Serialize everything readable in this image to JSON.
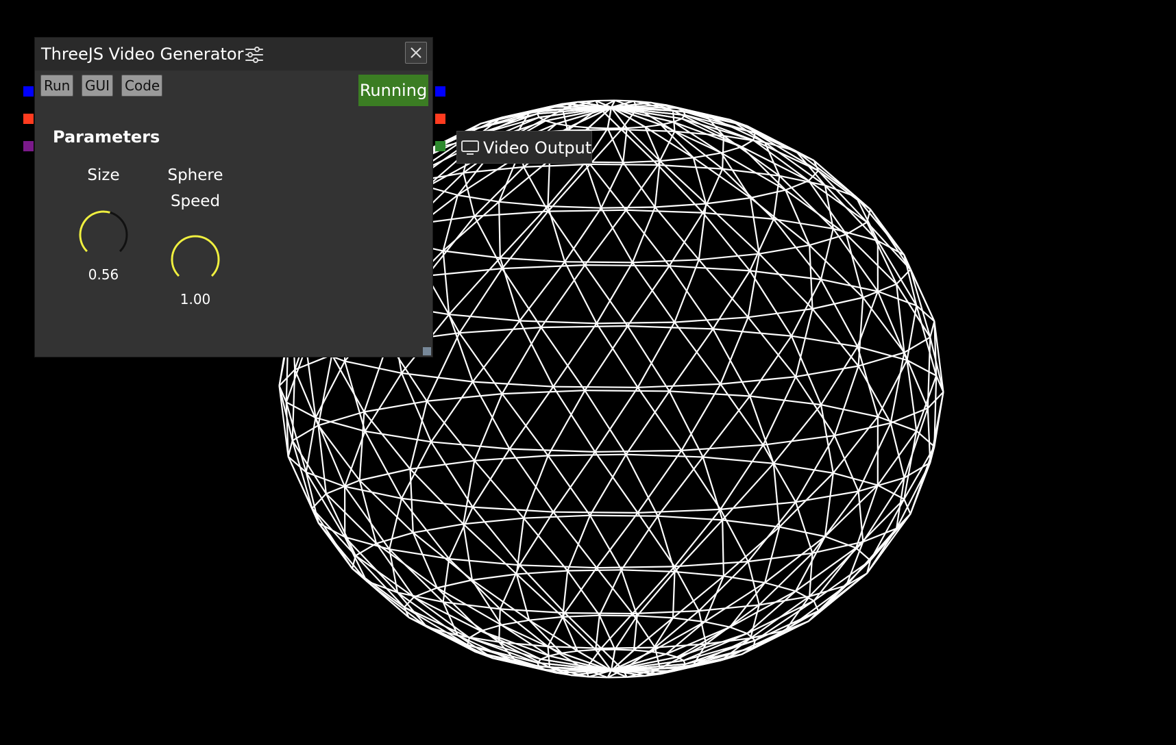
{
  "window": {
    "title": "ThreeJS Video Generator",
    "title_icon": "sliders-icon",
    "close_icon": "close-icon"
  },
  "toolbar": {
    "run_label": "Run",
    "gui_label": "GUI",
    "code_label": "Code"
  },
  "status": {
    "label": "Running",
    "color": "#3b7d23"
  },
  "parameters": {
    "heading": "Parameters",
    "knobs": [
      {
        "label": "Size",
        "label_line2": "",
        "value_text": "0.56",
        "value": 0.56
      },
      {
        "label": "Sphere",
        "label_line2": "Speed",
        "value_text": "1.00",
        "value": 1.0
      }
    ],
    "knob_accent_color": "#f0f040"
  },
  "ports": {
    "inputs": [
      "#0000ff",
      "#ff3b1f",
      "#7a1a8a"
    ],
    "outputs": [
      "#0000ff",
      "#ff3b1f",
      "#2e8a2e"
    ]
  },
  "video_output": {
    "label": "Video Output",
    "icon": "monitor-icon"
  },
  "scene": {
    "background": "#000000",
    "wireframe_color": "#ffffff"
  }
}
